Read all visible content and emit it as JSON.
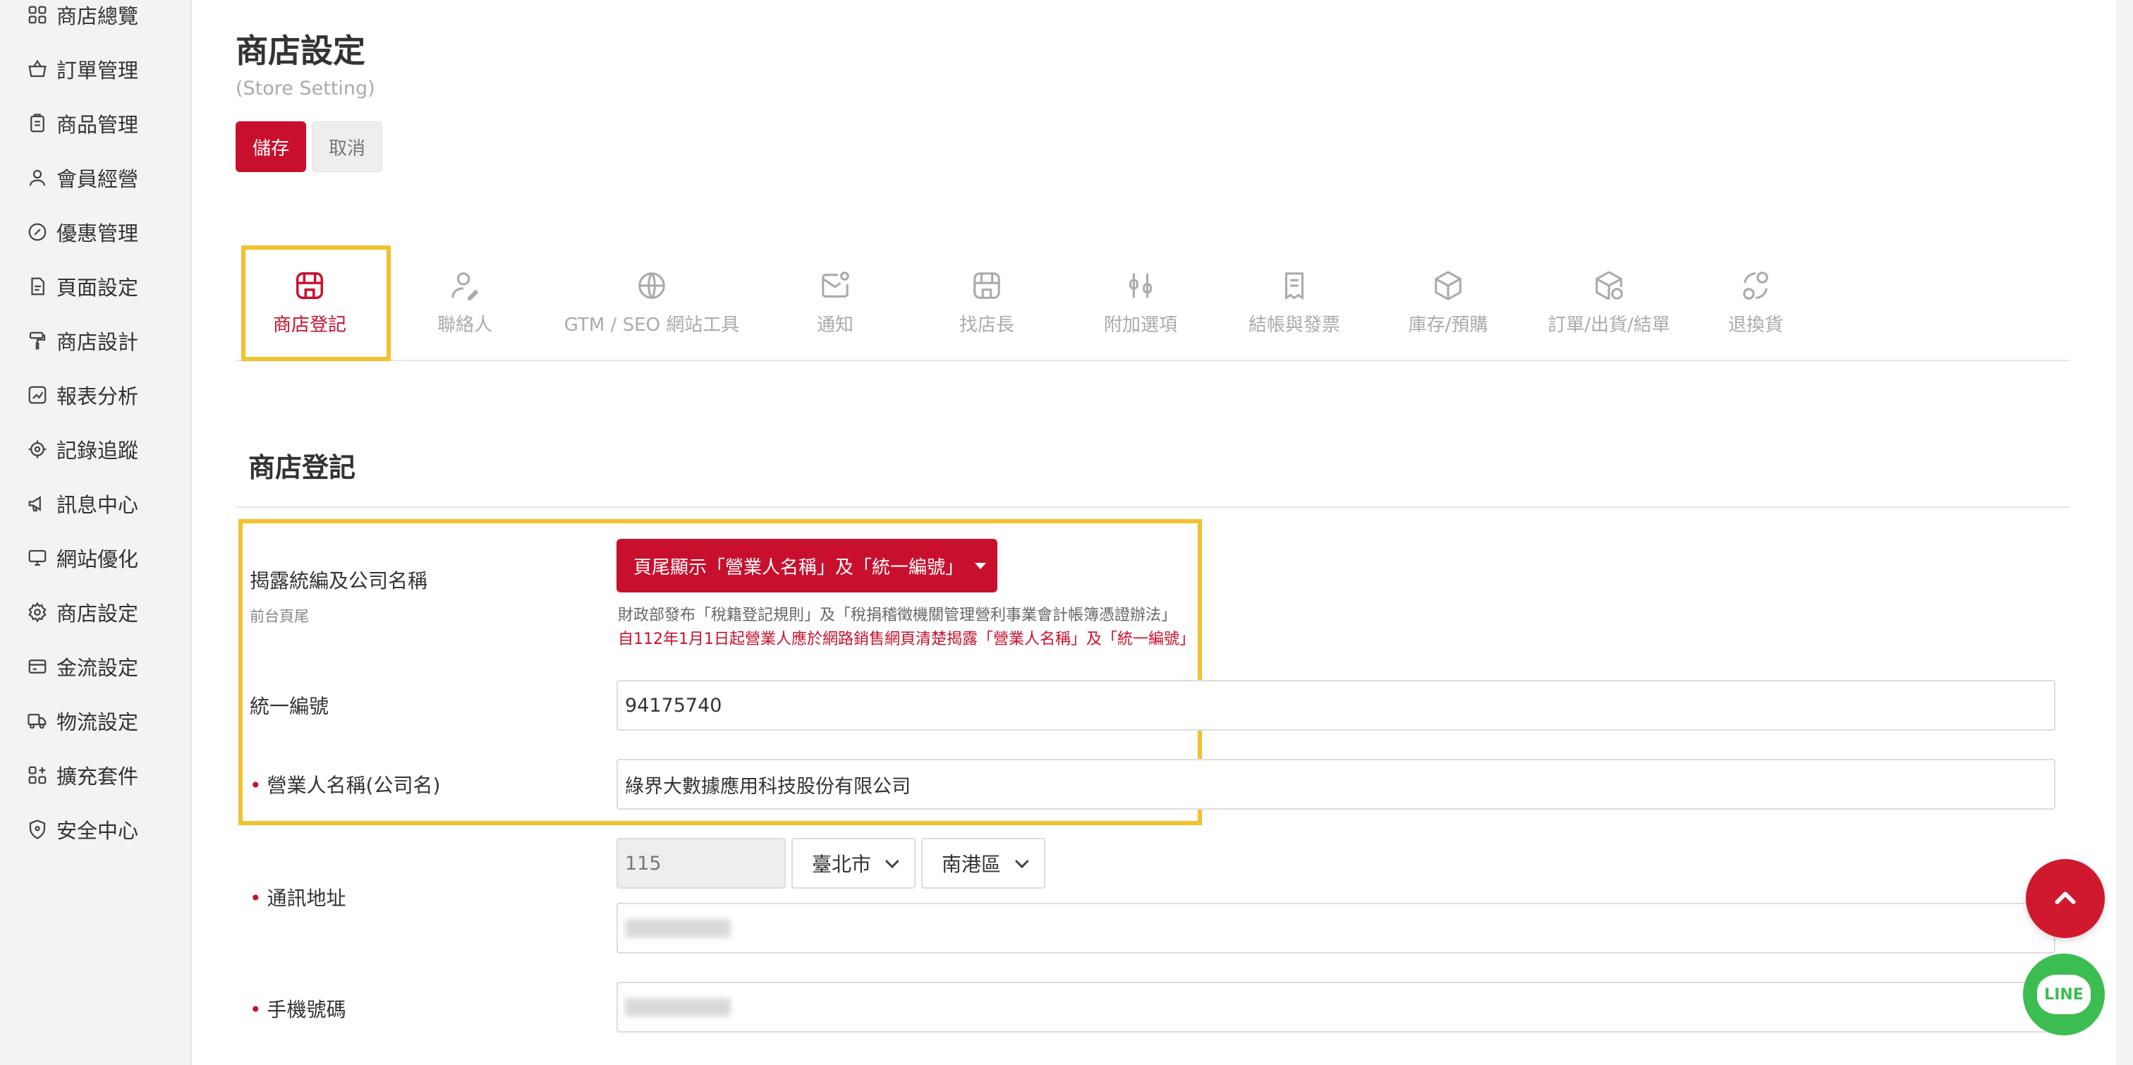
{
  "sidebar": {
    "items": [
      {
        "label": "商店總覽",
        "icon": "grid-icon"
      },
      {
        "label": "訂單管理",
        "icon": "basket-icon"
      },
      {
        "label": "商品管理",
        "icon": "clipboard-icon"
      },
      {
        "label": "會員經營",
        "icon": "user-icon"
      },
      {
        "label": "優惠管理",
        "icon": "badge-icon"
      },
      {
        "label": "頁面設定",
        "icon": "document-icon"
      },
      {
        "label": "商店設計",
        "icon": "paint-roller-icon"
      },
      {
        "label": "報表分析",
        "icon": "chart-icon"
      },
      {
        "label": "記錄追蹤",
        "icon": "target-icon"
      },
      {
        "label": "訊息中心",
        "icon": "megaphone-icon"
      },
      {
        "label": "網站優化",
        "icon": "monitor-icon"
      },
      {
        "label": "商店設定",
        "icon": "gear-icon"
      },
      {
        "label": "金流設定",
        "icon": "credit-card-icon"
      },
      {
        "label": "物流設定",
        "icon": "truck-icon"
      },
      {
        "label": "擴充套件",
        "icon": "plugin-icon"
      },
      {
        "label": "安全中心",
        "icon": "shield-icon"
      }
    ]
  },
  "header": {
    "title": "商店設定",
    "subtitle": "(Store Setting)",
    "save_label": "儲存",
    "cancel_label": "取消"
  },
  "tabs": [
    {
      "label": "商店登記",
      "icon": "store-icon",
      "active": true
    },
    {
      "label": "聯絡人",
      "icon": "contact-icon",
      "active": false
    },
    {
      "label": "GTM / SEO 網站工具",
      "icon": "globe-icon",
      "active": false
    },
    {
      "label": "通知",
      "icon": "mail-notification-icon",
      "active": false
    },
    {
      "label": "找店長",
      "icon": "storefront-icon",
      "active": false
    },
    {
      "label": "附加選項",
      "icon": "sliders-icon",
      "active": false
    },
    {
      "label": "結帳與發票",
      "icon": "receipt-icon",
      "active": false
    },
    {
      "label": "庫存/預購",
      "icon": "box-icon",
      "active": false
    },
    {
      "label": "訂單/出貨/結單",
      "icon": "package-check-icon",
      "active": false
    },
    {
      "label": "退換貨",
      "icon": "return-icon",
      "active": false
    }
  ],
  "section": {
    "title": "商店登記"
  },
  "form": {
    "disclosure": {
      "label": "揭露統編及公司名稱",
      "sublabel": "前台頁尾",
      "dropdown_value": "頁尾顯示「營業人名稱」及「統一編號」",
      "note": "財政部發布「稅籍登記規則」及「稅捐稽徵機關管理營利事業會計帳簿憑證辦法」",
      "note_red": "自112年1月1日起營業人應於網路銷售網頁清楚揭露「營業人名稱」及「統一編號」"
    },
    "tax_id": {
      "label": "統一編號",
      "value": "94175740"
    },
    "company_name": {
      "label": "營業人名稱(公司名)",
      "value": "綠界大數據應用科技股份有限公司"
    },
    "address": {
      "label": "通訊地址",
      "zip": "115",
      "city": "臺北市",
      "district": "南港區"
    },
    "mobile": {
      "label": "手機號碼"
    }
  },
  "fabs": {
    "line_label": "LINE"
  },
  "colors": {
    "brand_red": "#c8102e",
    "highlight_yellow": "#f2c12e",
    "line_green": "#3cbd52"
  }
}
